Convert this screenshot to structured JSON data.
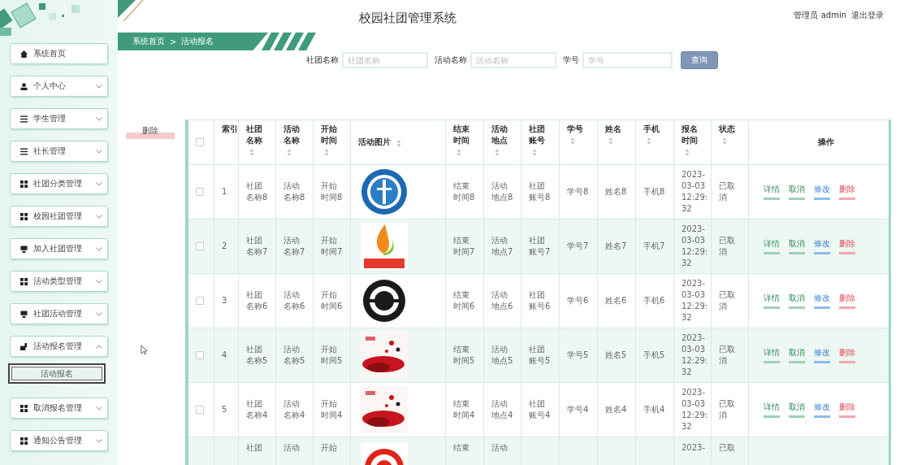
{
  "header": {
    "title": "校园社团管理系统",
    "user": "管理员 admin",
    "logout": "退出登录"
  },
  "sidebar": {
    "items": [
      {
        "label": "系统首页"
      },
      {
        "label": "个人中心",
        "expanded": false
      },
      {
        "label": "学生管理",
        "expanded": false
      },
      {
        "label": "社长管理",
        "expanded": false
      },
      {
        "label": "社团分类管理",
        "expanded": false
      },
      {
        "label": "校园社团管理",
        "expanded": false
      },
      {
        "label": "加入社团管理",
        "expanded": false
      },
      {
        "label": "活动类型管理",
        "expanded": false
      },
      {
        "label": "社团活动管理",
        "expanded": false
      },
      {
        "label": "活动报名管理",
        "expanded": true,
        "children": [
          {
            "label": "活动报名",
            "selected": true
          }
        ]
      },
      {
        "label": "取消报名管理",
        "expanded": false
      },
      {
        "label": "通知公告管理",
        "expanded": false
      }
    ]
  },
  "breadcrumb": [
    "系统首页",
    ">",
    "活动报名"
  ],
  "search": {
    "fields": [
      {
        "label": "社团名称",
        "placeholder": "社团名称"
      },
      {
        "label": "活动名称",
        "placeholder": "活动名称"
      },
      {
        "label": "学号",
        "placeholder": "学号"
      }
    ],
    "button": "查询"
  },
  "delete_button": "删除",
  "table": {
    "header_checked": false,
    "columns": [
      {
        "label": "索引",
        "sortable": false
      },
      {
        "label": "社团名称",
        "sortable": true
      },
      {
        "label": "活动名称",
        "sortable": true
      },
      {
        "label": "开始时间",
        "sortable": true
      },
      {
        "label": "活动图片",
        "sortable": true
      },
      {
        "label": "结束时间",
        "sortable": true
      },
      {
        "label": "活动地点",
        "sortable": true
      },
      {
        "label": "社团账号",
        "sortable": true
      },
      {
        "label": "学号",
        "sortable": true
      },
      {
        "label": "姓名",
        "sortable": true
      },
      {
        "label": "手机",
        "sortable": true
      },
      {
        "label": "报名时间",
        "sortable": true
      },
      {
        "label": "状态",
        "sortable": true
      },
      {
        "label": "操作",
        "sortable": false
      }
    ],
    "rows": [
      {
        "checked": false,
        "index": "1",
        "club": "社团名称8",
        "activity": "活动名称8",
        "start": "开始时间8",
        "end": "结束时间8",
        "place": "活动地点8",
        "account": "社团账号8",
        "student_no": "学号8",
        "name": "姓名8",
        "phone": "手机8",
        "reg_time": "2023-03-03 12:29:32",
        "status": "已取消",
        "actions": [
          {
            "label": "详情",
            "kind": "detail"
          },
          {
            "label": "取消",
            "kind": "cancel"
          },
          {
            "label": "修改",
            "kind": "edit"
          },
          {
            "label": "删除",
            "kind": "delete"
          }
        ]
      },
      {
        "checked": false,
        "index": "2",
        "club": "社团名称7",
        "activity": "活动名称7",
        "start": "开始时间7",
        "end": "结束时间7",
        "place": "活动地点7",
        "account": "社团账号7",
        "student_no": "学号7",
        "name": "姓名7",
        "phone": "手机7",
        "reg_time": "2023-03-03 12:29:32",
        "status": "已取消",
        "actions": [
          {
            "label": "详情",
            "kind": "detail"
          },
          {
            "label": "取消",
            "kind": "cancel"
          },
          {
            "label": "修改",
            "kind": "edit"
          },
          {
            "label": "删除",
            "kind": "delete"
          }
        ]
      },
      {
        "checked": false,
        "index": "3",
        "club": "社团名称6",
        "activity": "活动名称6",
        "start": "开始时间6",
        "end": "结束时间6",
        "place": "活动地点6",
        "account": "社团账号6",
        "student_no": "学号6",
        "name": "姓名6",
        "phone": "手机6",
        "reg_time": "2023-03-03 12:29:32",
        "status": "已取消",
        "actions": [
          {
            "label": "详情",
            "kind": "detail"
          },
          {
            "label": "取消",
            "kind": "cancel"
          },
          {
            "label": "修改",
            "kind": "edit"
          },
          {
            "label": "删除",
            "kind": "delete"
          }
        ]
      },
      {
        "checked": false,
        "index": "4",
        "club": "社团名称5",
        "activity": "活动名称5",
        "start": "开始时间5",
        "end": "结束时间5",
        "place": "活动地点5",
        "account": "社团账号5",
        "student_no": "学号5",
        "name": "姓名5",
        "phone": "手机5",
        "reg_time": "2023-03-03 12:29:32",
        "status": "已取消",
        "actions": [
          {
            "label": "详情",
            "kind": "detail"
          },
          {
            "label": "取消",
            "kind": "cancel"
          },
          {
            "label": "修改",
            "kind": "edit"
          },
          {
            "label": "删除",
            "kind": "delete"
          }
        ]
      },
      {
        "checked": false,
        "index": "5",
        "club": "社团名称4",
        "activity": "活动名称4",
        "start": "开始时间4",
        "end": "结束时间4",
        "place": "活动地点4",
        "account": "社团账号4",
        "student_no": "学号4",
        "name": "姓名4",
        "phone": "手机4",
        "reg_time": "2023-03-03 12:29:32",
        "status": "已取消",
        "actions": [
          {
            "label": "详情",
            "kind": "detail"
          },
          {
            "label": "取消",
            "kind": "cancel"
          },
          {
            "label": "修改",
            "kind": "edit"
          },
          {
            "label": "删除",
            "kind": "delete"
          }
        ]
      },
      {
        "index": "",
        "club": "社团",
        "activity": "活动",
        "start": "开始",
        "end": "结束",
        "place": "活动",
        "reg_time": "2023-",
        "status": "已取"
      }
    ]
  }
}
